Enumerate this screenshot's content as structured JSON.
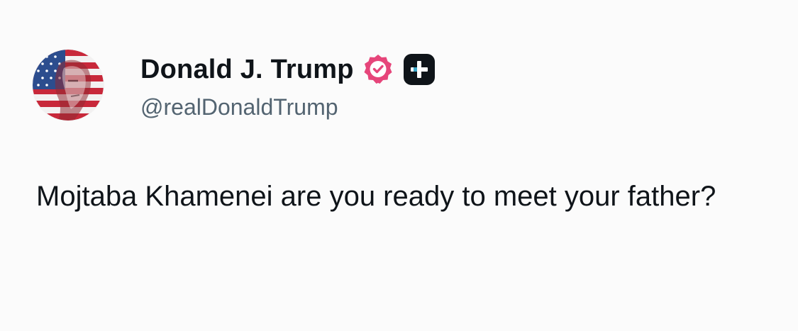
{
  "post": {
    "author": {
      "display_name": "Donald J. Trump",
      "handle": "@realDonaldTrump",
      "avatar_icon": "flag-portrait-avatar",
      "verified_icon": "verified-badge-icon",
      "verified_color": "#e6457a",
      "plus_icon": "plus-app-icon"
    },
    "text": "Mojtaba Khamenei are you ready to meet your father?"
  }
}
